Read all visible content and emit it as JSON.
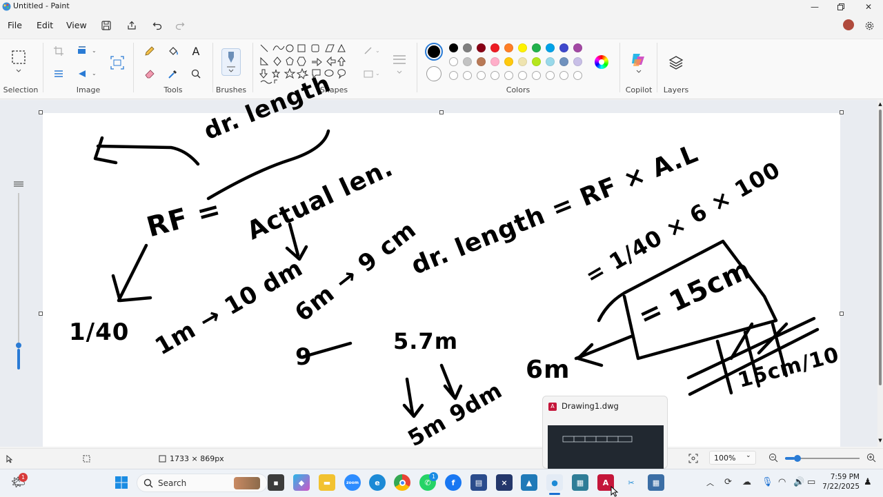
{
  "window": {
    "title": "Untitled - Paint"
  },
  "menu": {
    "file": "File",
    "edit": "Edit",
    "view": "View"
  },
  "ribbon": {
    "groups": {
      "selection": "Selection",
      "image": "Image",
      "tools": "Tools",
      "brushes": "Brushes",
      "shapes": "Shapes",
      "colors": "Colors",
      "copilot": "Copilot",
      "layers": "Layers"
    },
    "palette_row1": [
      "#000000",
      "#7f7f7f",
      "#880015",
      "#ed1c24",
      "#ff7f27",
      "#fff200",
      "#22b14c",
      "#00a2e8",
      "#3f48cc",
      "#a349a4"
    ],
    "palette_row2": [
      "#ffffff",
      "#c3c3c3",
      "#b97a57",
      "#ffaec9",
      "#ffc90e",
      "#efe4b0",
      "#b5e61d",
      "#99d9ea",
      "#7092be",
      "#c8bfe7"
    ],
    "primary_color": "#000000",
    "secondary_color": "#ffffff"
  },
  "canvas": {
    "handwriting": [
      "dr. length",
      "RF =",
      "Actual len.",
      "1/40",
      "1m → 10 dm",
      "6m → 9 cm",
      "9",
      "dr. length = RF × A.L",
      "= 1/40 × 6 × 100",
      "= 15cm",
      "5.7m",
      "5m 9dm",
      "6m",
      "15cm/10"
    ]
  },
  "status": {
    "canvas_size": "1733 × 869px",
    "zoom": "100%"
  },
  "popup": {
    "title": "Drawing1.dwg"
  },
  "taskbar": {
    "search_placeholder": "Search",
    "time": "7:59 PM",
    "date": "7/22/2025",
    "notification_count": "1",
    "whatsapp_badge": "1"
  }
}
